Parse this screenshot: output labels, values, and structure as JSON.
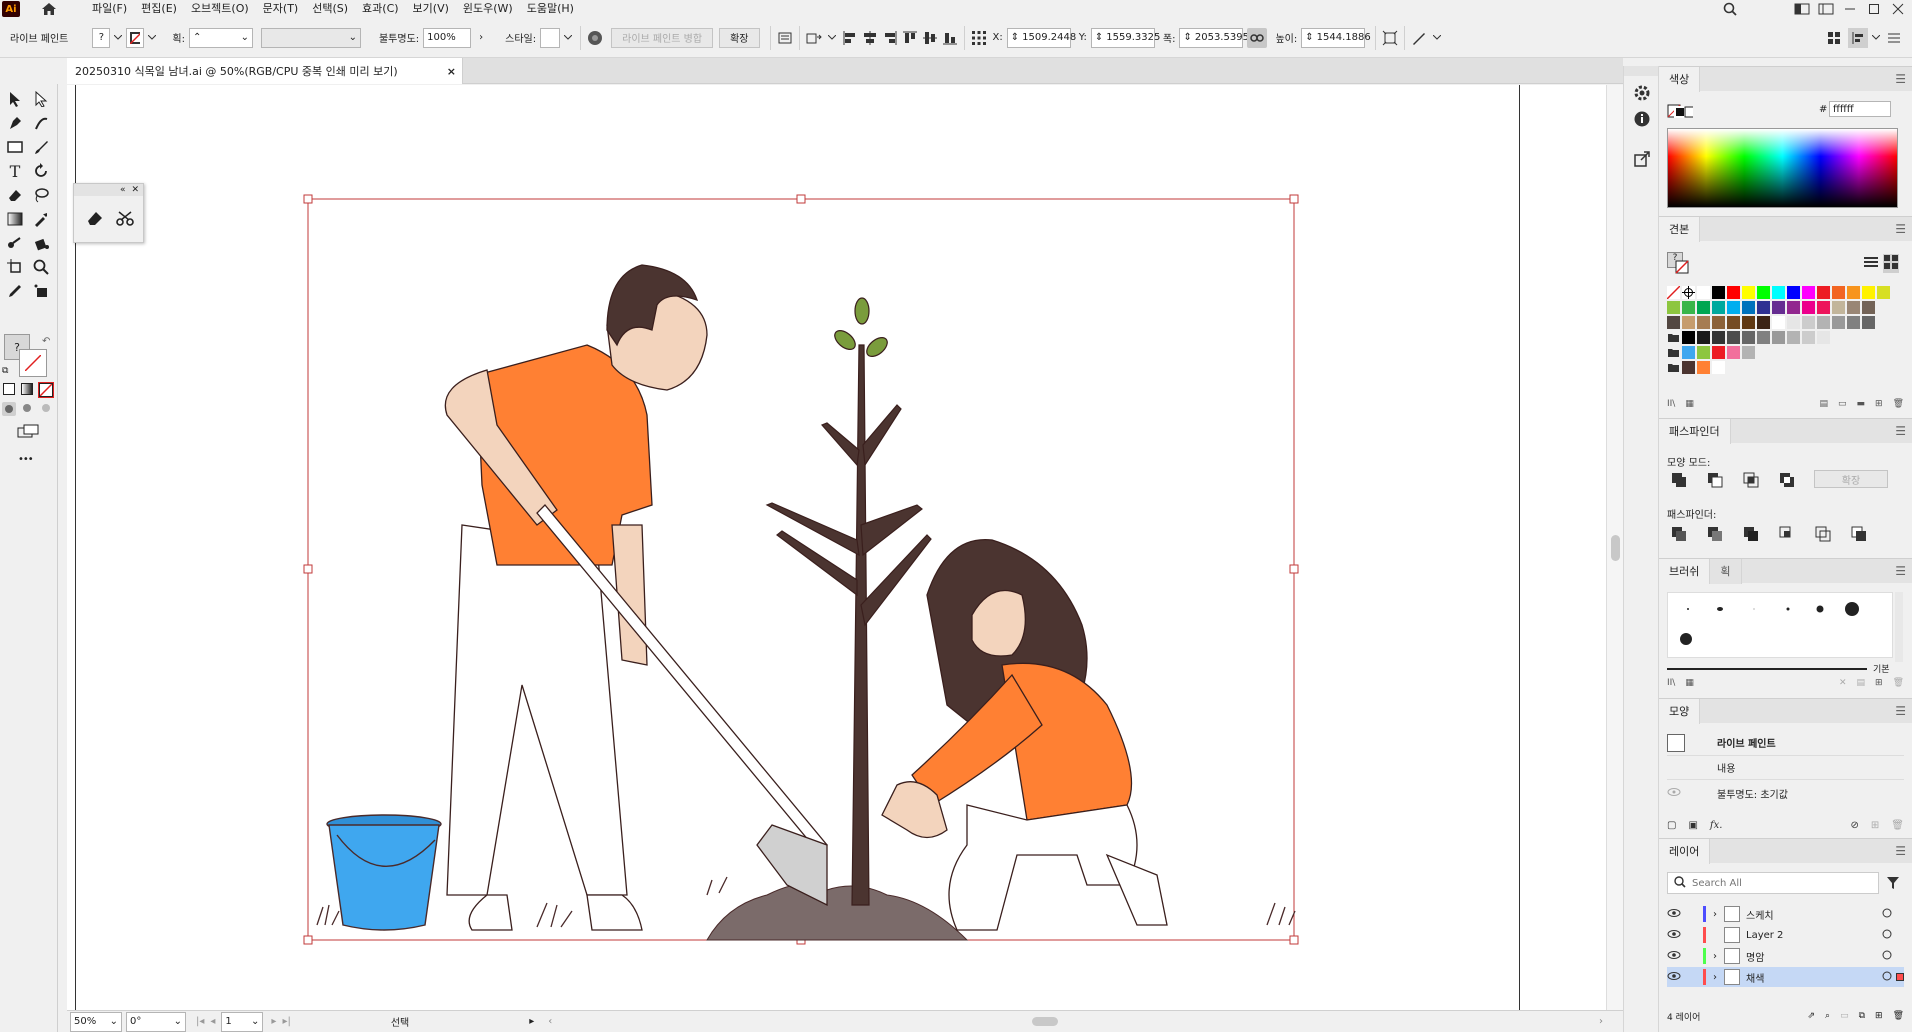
{
  "app": {
    "logo": "Ai"
  },
  "menu": [
    "파일(F)",
    "편집(E)",
    "오브젝트(O)",
    "문자(T)",
    "선택(S)",
    "효과(C)",
    "보기(V)",
    "윈도우(W)",
    "도움말(H)"
  ],
  "control": {
    "tool_label": "라이브 페인트",
    "fill_q": "?",
    "stroke_label": "획:",
    "opacity_label": "불투명도:",
    "opacity_value": "100%",
    "style_label": "스타일:",
    "merge_btn": "라이브 페인트 병합",
    "expand_btn": "확장",
    "x_label": "X:",
    "x_value": "1509.2448",
    "y_label": "Y:",
    "y_value": "1559.3325",
    "w_label": "폭:",
    "w_value": "2053.5395",
    "h_label": "높이:",
    "h_value": "1544.1886"
  },
  "document": {
    "tab_title": "20250310 식목일 남녀.ai @ 50%(RGB/CPU 중복 인쇄 미리 보기)",
    "close": "×"
  },
  "tools": {
    "fill_q": "?",
    "more": "•••"
  },
  "status": {
    "zoom": "50%",
    "rotate": "0°",
    "artboard": "1",
    "mode": "선택"
  },
  "colors": {
    "accent": "#1473e6",
    "orange": "#ff8033",
    "bucket": "#3fa7ef",
    "soil": "#7b6b6a",
    "hair": "#4b3430",
    "bound": "#c03a3a"
  },
  "panels": {
    "color": {
      "title": "색상",
      "hex": "ffffff",
      "hash": "#"
    },
    "swatches": {
      "title": "견본",
      "fill_q": "?"
    },
    "pathfinder": {
      "title": "패스파인더",
      "shape_modes": "모양 모드:",
      "expand": "확장",
      "pathfinders": "패스파인더:"
    },
    "brushes": {
      "title": "브러쉬",
      "tab2": "획",
      "basic": "기본"
    },
    "appearance": {
      "title": "모양",
      "object": "라이브 페인트",
      "contents": "내용",
      "opacity": "불투명도: 초기값",
      "fx": "fx."
    },
    "layers": {
      "title": "레이어",
      "search_placeholder": "Search All",
      "count": "4 레이어",
      "items": [
        {
          "name": "스케치",
          "color": "#4d4dff"
        },
        {
          "name": "Layer 2",
          "color": "#ff4d4d"
        },
        {
          "name": "명암",
          "color": "#4dff4d"
        },
        {
          "name": "채색",
          "color": "#ff4d4d"
        }
      ]
    }
  }
}
